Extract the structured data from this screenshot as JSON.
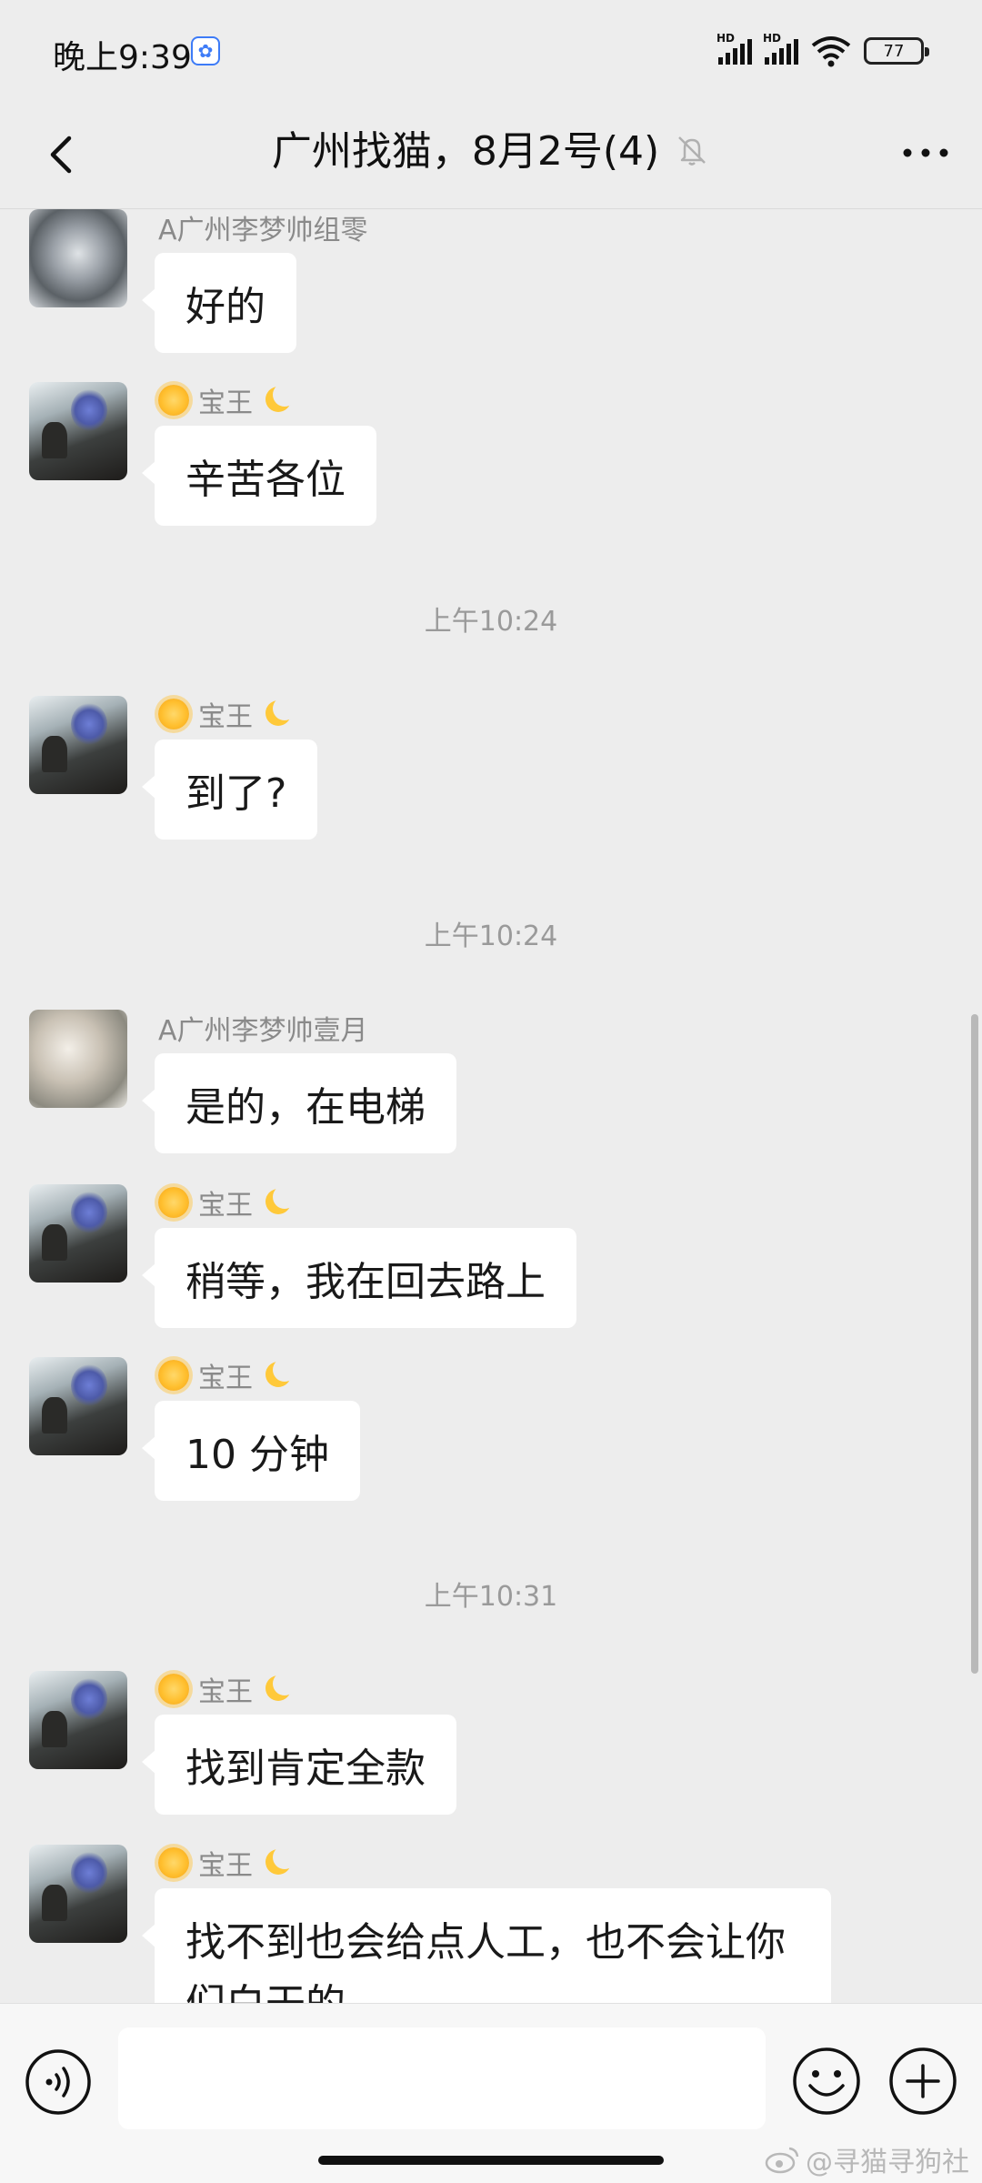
{
  "status_bar": {
    "time": "晚上9:39",
    "battery": "77",
    "signal_labels": [
      "HD",
      "HD"
    ]
  },
  "nav": {
    "title": "广州找猫，8月2号(4)"
  },
  "messages": [
    {
      "sender": "A广州李梦帅组零",
      "text": "好的"
    },
    {
      "sender": "宝王",
      "text": "辛苦各位"
    },
    {
      "timestamp": "上午10:24"
    },
    {
      "sender": "宝王",
      "text": "到了?"
    },
    {
      "timestamp": "上午10:24"
    },
    {
      "sender": "A广州李梦帅壹月",
      "text": "是的，在电梯"
    },
    {
      "sender": "宝王",
      "text": "稍等，我在回去路上"
    },
    {
      "sender": "宝王",
      "text": "10 分钟"
    },
    {
      "timestamp": "上午10:31"
    },
    {
      "sender": "宝王",
      "text": "找到肯定全款"
    },
    {
      "sender": "宝王",
      "text": "找不到也会给点人工，也不会让你们白干的"
    }
  ],
  "input": {
    "value": "",
    "placeholder": ""
  },
  "watermark": "@寻猫寻狗社",
  "colors": {
    "background": "#ededed",
    "bubble": "#ffffff",
    "sender_name": "#8a8a8a",
    "timestamp": "#9a9a9a"
  },
  "icons": {
    "back": "chevron-left-icon",
    "mute": "bell-off-icon",
    "more": "more-dots-icon",
    "voice": "voice-icon",
    "emoji": "emoji-icon",
    "plus": "plus-icon"
  }
}
